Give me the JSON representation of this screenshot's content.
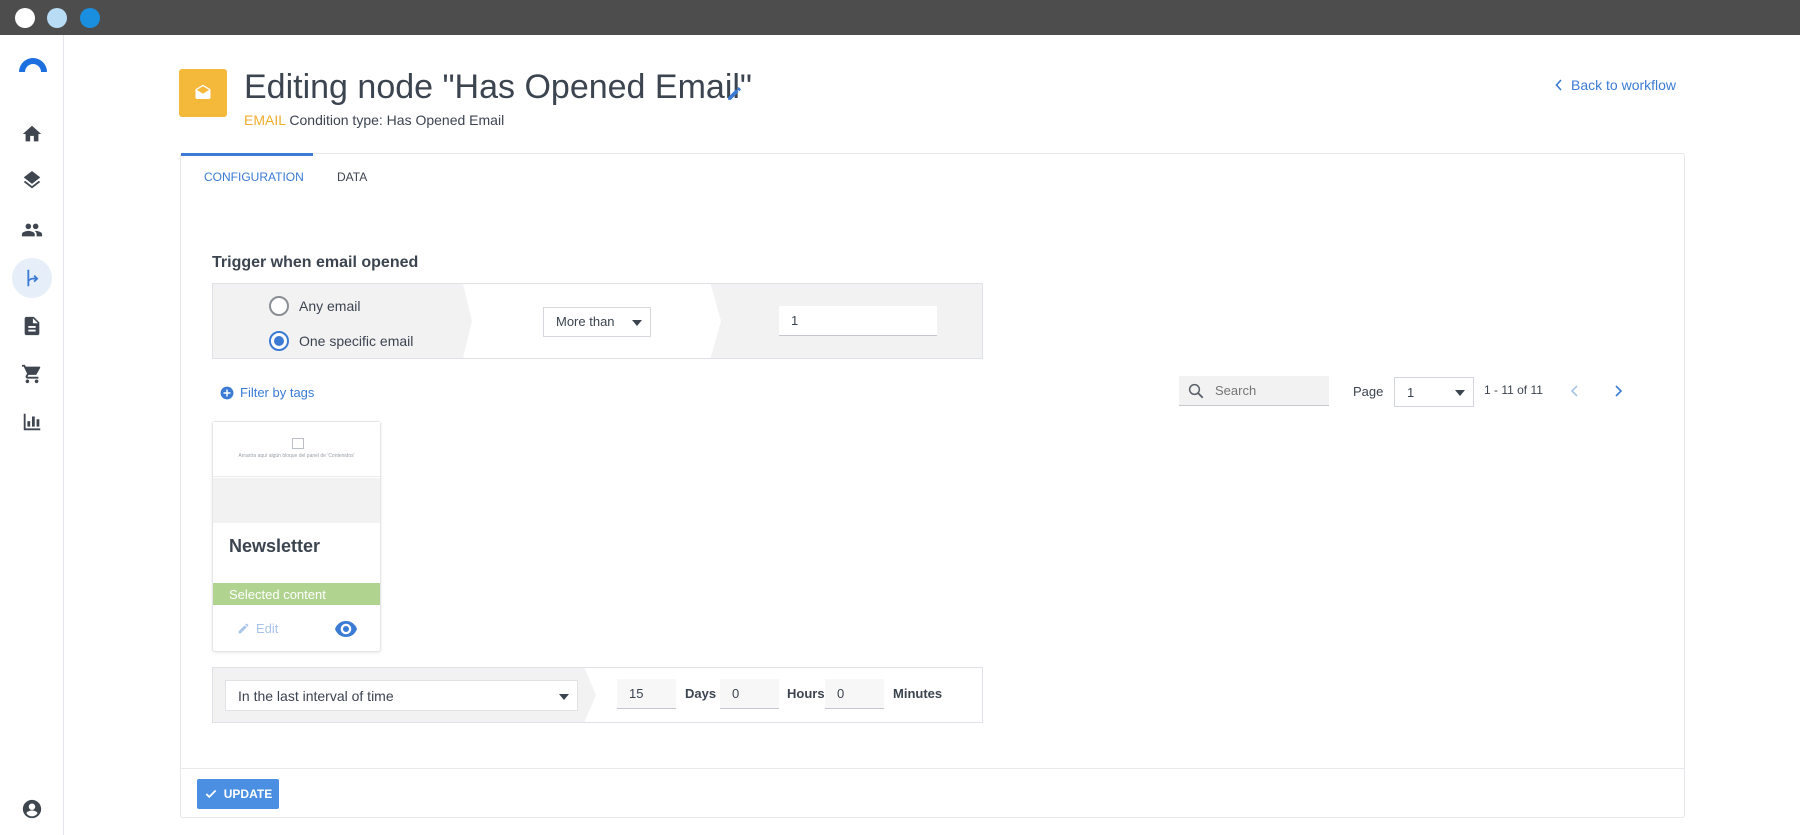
{
  "window": {
    "traffic_lights": [
      "#ffffff",
      "#b9dcf5",
      "#1a8fe0"
    ]
  },
  "sidebar": {
    "items": [
      {
        "icon": "home-icon"
      },
      {
        "icon": "layers-icon"
      },
      {
        "icon": "people-icon"
      },
      {
        "icon": "workflow-icon",
        "active": true
      },
      {
        "icon": "document-icon"
      },
      {
        "icon": "cart-icon"
      },
      {
        "icon": "bar-chart-icon"
      }
    ],
    "bottom_icon": "account-icon"
  },
  "header": {
    "title": "Editing node \"Has Opened Email\"",
    "subtitle_tag": "EMAIL",
    "subtitle_text": "Condition type: Has Opened Email",
    "back_link": "Back to workflow",
    "icon_color": "#f4b83a"
  },
  "tabs": [
    {
      "label": "CONFIGURATION",
      "active": true
    },
    {
      "label": "DATA",
      "active": false
    }
  ],
  "trigger": {
    "title": "Trigger when email opened",
    "options": [
      {
        "label": "Any email",
        "checked": false
      },
      {
        "label": "One specific email",
        "checked": true
      }
    ],
    "comparison": "More than",
    "count": "1"
  },
  "filter": {
    "label": "Filter by tags",
    "search_placeholder": "Search",
    "page_label": "Page",
    "page_value": "1",
    "range_text": "1 - 11 of 11"
  },
  "email_card": {
    "preview_text": "Arrastra aquí algún bloque del panel de 'Contenidos'",
    "name": "Newsletter",
    "status": "Selected content",
    "edit_label": "Edit"
  },
  "interval": {
    "mode": "In the last interval of time",
    "days": "15",
    "days_label": "Days",
    "hours": "0",
    "hours_label": "Hours",
    "minutes": "0",
    "minutes_label": "Minutes"
  },
  "footer": {
    "update_label": "UPDATE"
  },
  "colors": {
    "accent": "#3b7bd4",
    "selected": "#b0d38f",
    "email_tag": "#f0ad2e",
    "button": "#4b8fe2"
  }
}
